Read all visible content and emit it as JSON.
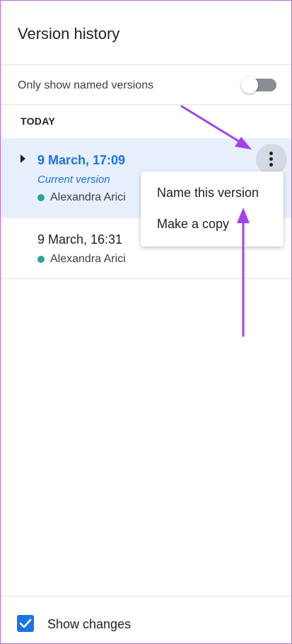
{
  "panel": {
    "title": "Version history",
    "filter": {
      "label": "Only show named versions",
      "enabled": false
    },
    "section_label": "TODAY",
    "versions": [
      {
        "time": "9 March, 17:09",
        "label": "Current version",
        "author": "Alexandra Arici",
        "author_color": "#26a69a",
        "selected": true
      },
      {
        "time": "9 March, 16:31",
        "author": "Alexandra Arici",
        "author_color": "#26a69a",
        "selected": false
      }
    ],
    "more_icon": "more-vert-icon",
    "menu": {
      "items": [
        {
          "label": "Name this version"
        },
        {
          "label": "Make a copy"
        }
      ]
    },
    "footer": {
      "label": "Show changes",
      "checked": true
    }
  },
  "colors": {
    "accent": "#1a73e8",
    "selected_row": "#e8f0fe",
    "annotation": "#a243ef",
    "frame_border": "#b56ad9"
  },
  "icons": {
    "expand": "triangle-right-icon",
    "checkbox": "checkmark-icon"
  }
}
